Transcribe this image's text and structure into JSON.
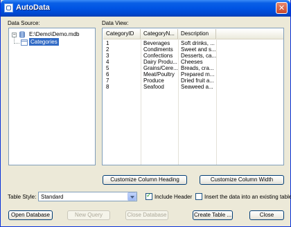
{
  "window": {
    "title": "AutoData"
  },
  "data_source": {
    "label": "Data Source:",
    "root": "E:\\Demo\\Demo.mdb",
    "selected": "Categories"
  },
  "data_view": {
    "label": "Data View:",
    "columns": [
      "CategoryID",
      "CategoryN...",
      "Description"
    ],
    "rows": [
      [
        "1",
        "Beverages",
        "Soft drinks, ..."
      ],
      [
        "2",
        "Condiments",
        "Sweet and s..."
      ],
      [
        "3",
        "Confections",
        "Desserts, ca..."
      ],
      [
        "4",
        "Dairy Produ...",
        "Cheeses"
      ],
      [
        "5",
        "Grains/Cere...",
        "Breads, cra..."
      ],
      [
        "6",
        "Meat/Poultry",
        "Prepared m..."
      ],
      [
        "7",
        "Produce",
        "Dried fruit a..."
      ],
      [
        "8",
        "Seafood",
        "Seaweed a..."
      ]
    ]
  },
  "buttons": {
    "customize_heading": "Customize Column Heading",
    "customize_width": "Customize Column Width",
    "open_database": "Open Database",
    "new_query": "New Query",
    "close_database": "Close Database",
    "create_table": "Create Table ...",
    "close": "Close"
  },
  "table_style": {
    "label": "Table Style:",
    "value": "Standard"
  },
  "include_header": {
    "label": "Include Header",
    "checked": true
  },
  "insert_existing": {
    "label": "Insert the data into an existing table",
    "checked": false
  }
}
